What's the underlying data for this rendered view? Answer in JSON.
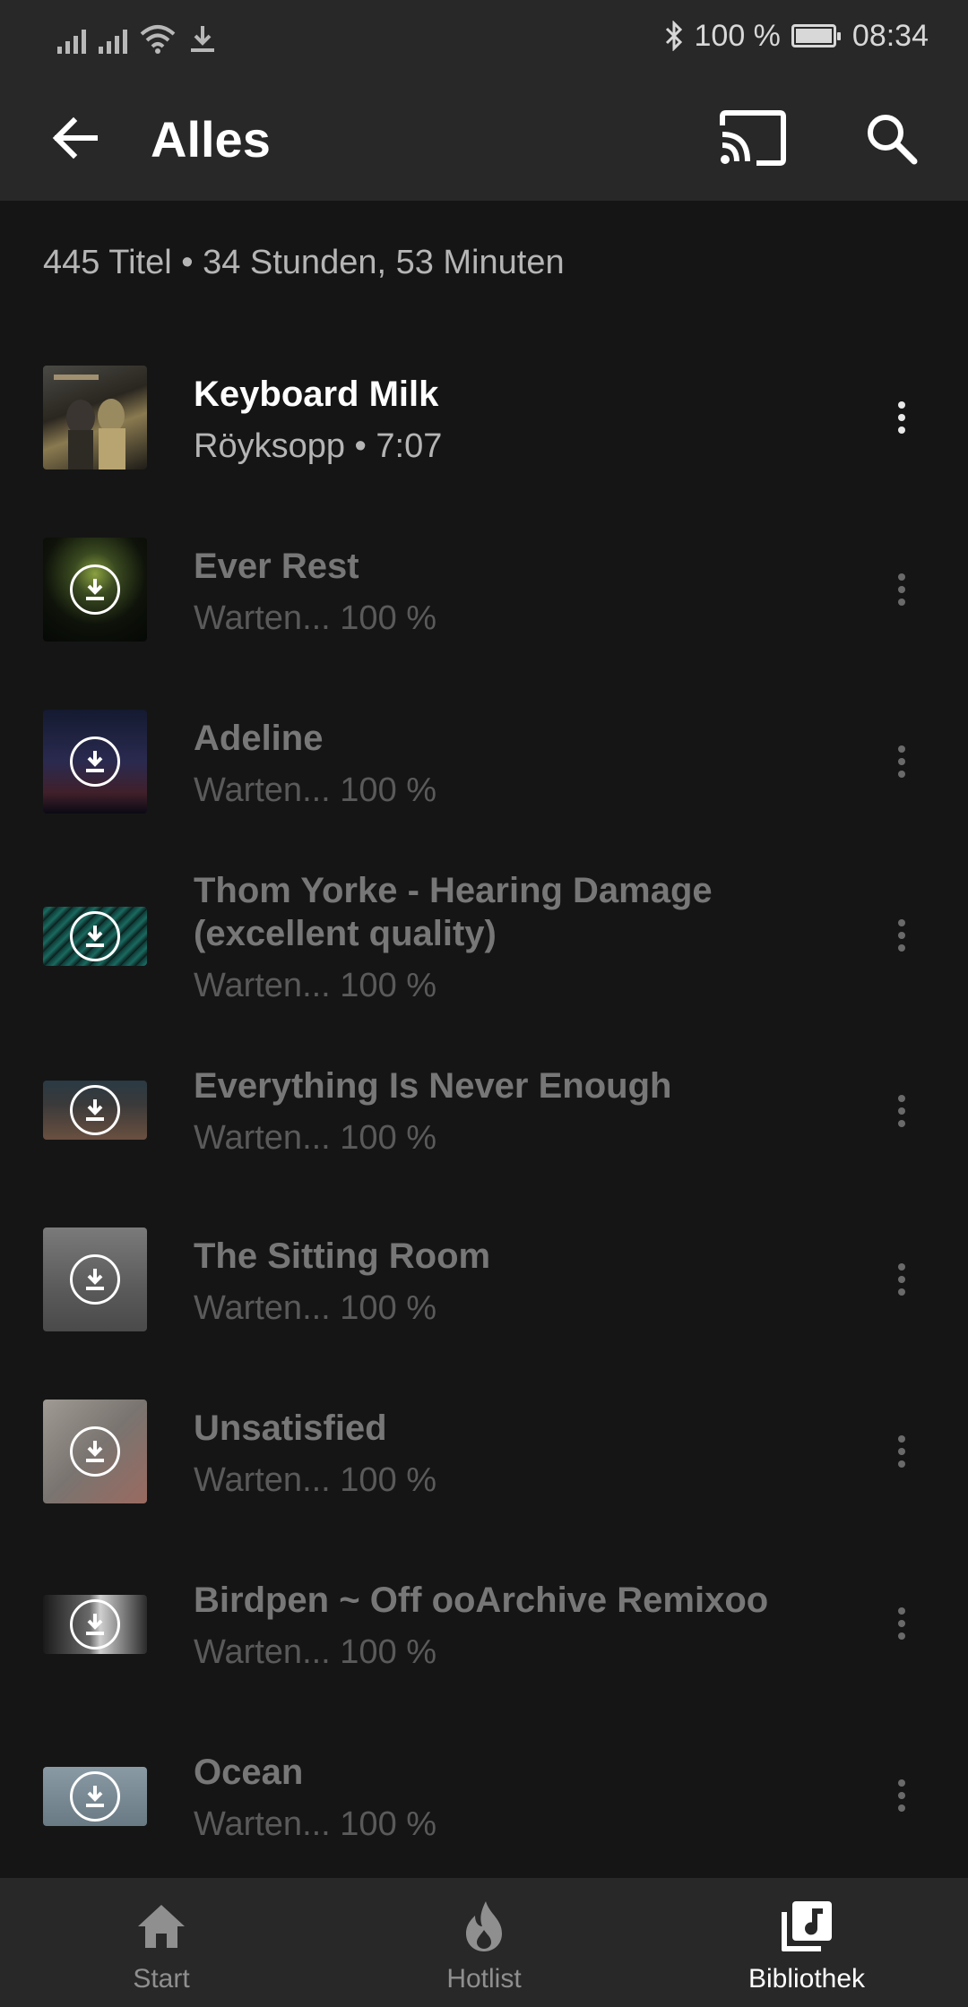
{
  "status_bar": {
    "battery": "100 %",
    "battery_level": 1.0,
    "time": "08:34"
  },
  "app_bar": {
    "title": "Alles",
    "icons": [
      "back-arrow-icon",
      "cast-icon",
      "search-icon"
    ]
  },
  "summary": "445 Titel • 34 Stunden, 53 Minuten",
  "tracks": [
    {
      "title": "Keyboard Milk",
      "subtitle": "Röyksopp • 7:07",
      "state": "playing"
    },
    {
      "title": "Ever Rest",
      "subtitle": "Warten... 100 %",
      "state": "pending"
    },
    {
      "title": "Adeline",
      "subtitle": "Warten... 100 %",
      "state": "pending"
    },
    {
      "title": "Thom Yorke - Hearing Damage (excellent quality)",
      "subtitle": "Warten... 100 %",
      "state": "pending"
    },
    {
      "title": "Everything Is Never Enough",
      "subtitle": "Warten... 100 %",
      "state": "pending"
    },
    {
      "title": "The Sitting Room",
      "subtitle": "Warten... 100 %",
      "state": "pending"
    },
    {
      "title": "Unsatisfied",
      "subtitle": "Warten... 100 %",
      "state": "pending"
    },
    {
      "title": "Birdpen ~ Off ooArchive Remixoo",
      "subtitle": "Warten... 100 %",
      "state": "pending"
    },
    {
      "title": "Ocean",
      "subtitle": "Warten... 100 %",
      "state": "pending"
    }
  ],
  "bottom_nav": [
    {
      "label": "Start",
      "icon": "home-icon",
      "selected": false
    },
    {
      "label": "Hotlist",
      "icon": "flame-icon",
      "selected": false
    },
    {
      "label": "Bibliothek",
      "icon": "library-music-icon",
      "selected": true
    }
  ],
  "colors": {
    "background": "#151515",
    "bar": "#282828",
    "primary_text": "#ffffff",
    "secondary_text": "#b5b5b5",
    "dimmed_text": "#777777"
  }
}
